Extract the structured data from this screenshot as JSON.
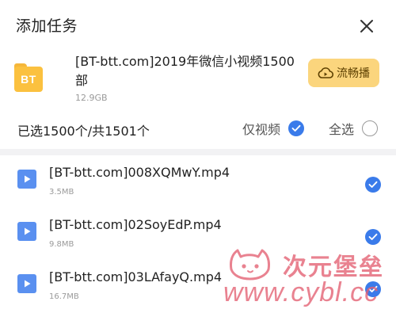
{
  "dialog": {
    "title": "添加任务"
  },
  "torrent": {
    "icon_text": "BT",
    "name": "[BT-btt.com]2019年微信小视频1500部",
    "size": "12.9GB",
    "play_label": "流畅播"
  },
  "selection": {
    "count_text": "已选1500个/共1501个",
    "video_only_label": "仅视频",
    "video_only_checked": true,
    "select_all_label": "全选",
    "select_all_checked": false
  },
  "files": [
    {
      "name": "[BT-btt.com]008XQMwY.mp4",
      "size": "3.5MB",
      "checked": true
    },
    {
      "name": "[BT-btt.com]02SoyEdP.mp4",
      "size": "9.8MB",
      "checked": true
    },
    {
      "name": "[BT-btt.com]03LAfayQ.mp4",
      "size": "16.7MB",
      "checked": true
    }
  ],
  "watermark": {
    "brand": "次元堡垒",
    "url": "www.cybl.cc"
  },
  "colors": {
    "accent": "#3a7bea",
    "pill": "#fbd57d",
    "folder": "#fbc13f",
    "watermark": "#e35f72"
  }
}
